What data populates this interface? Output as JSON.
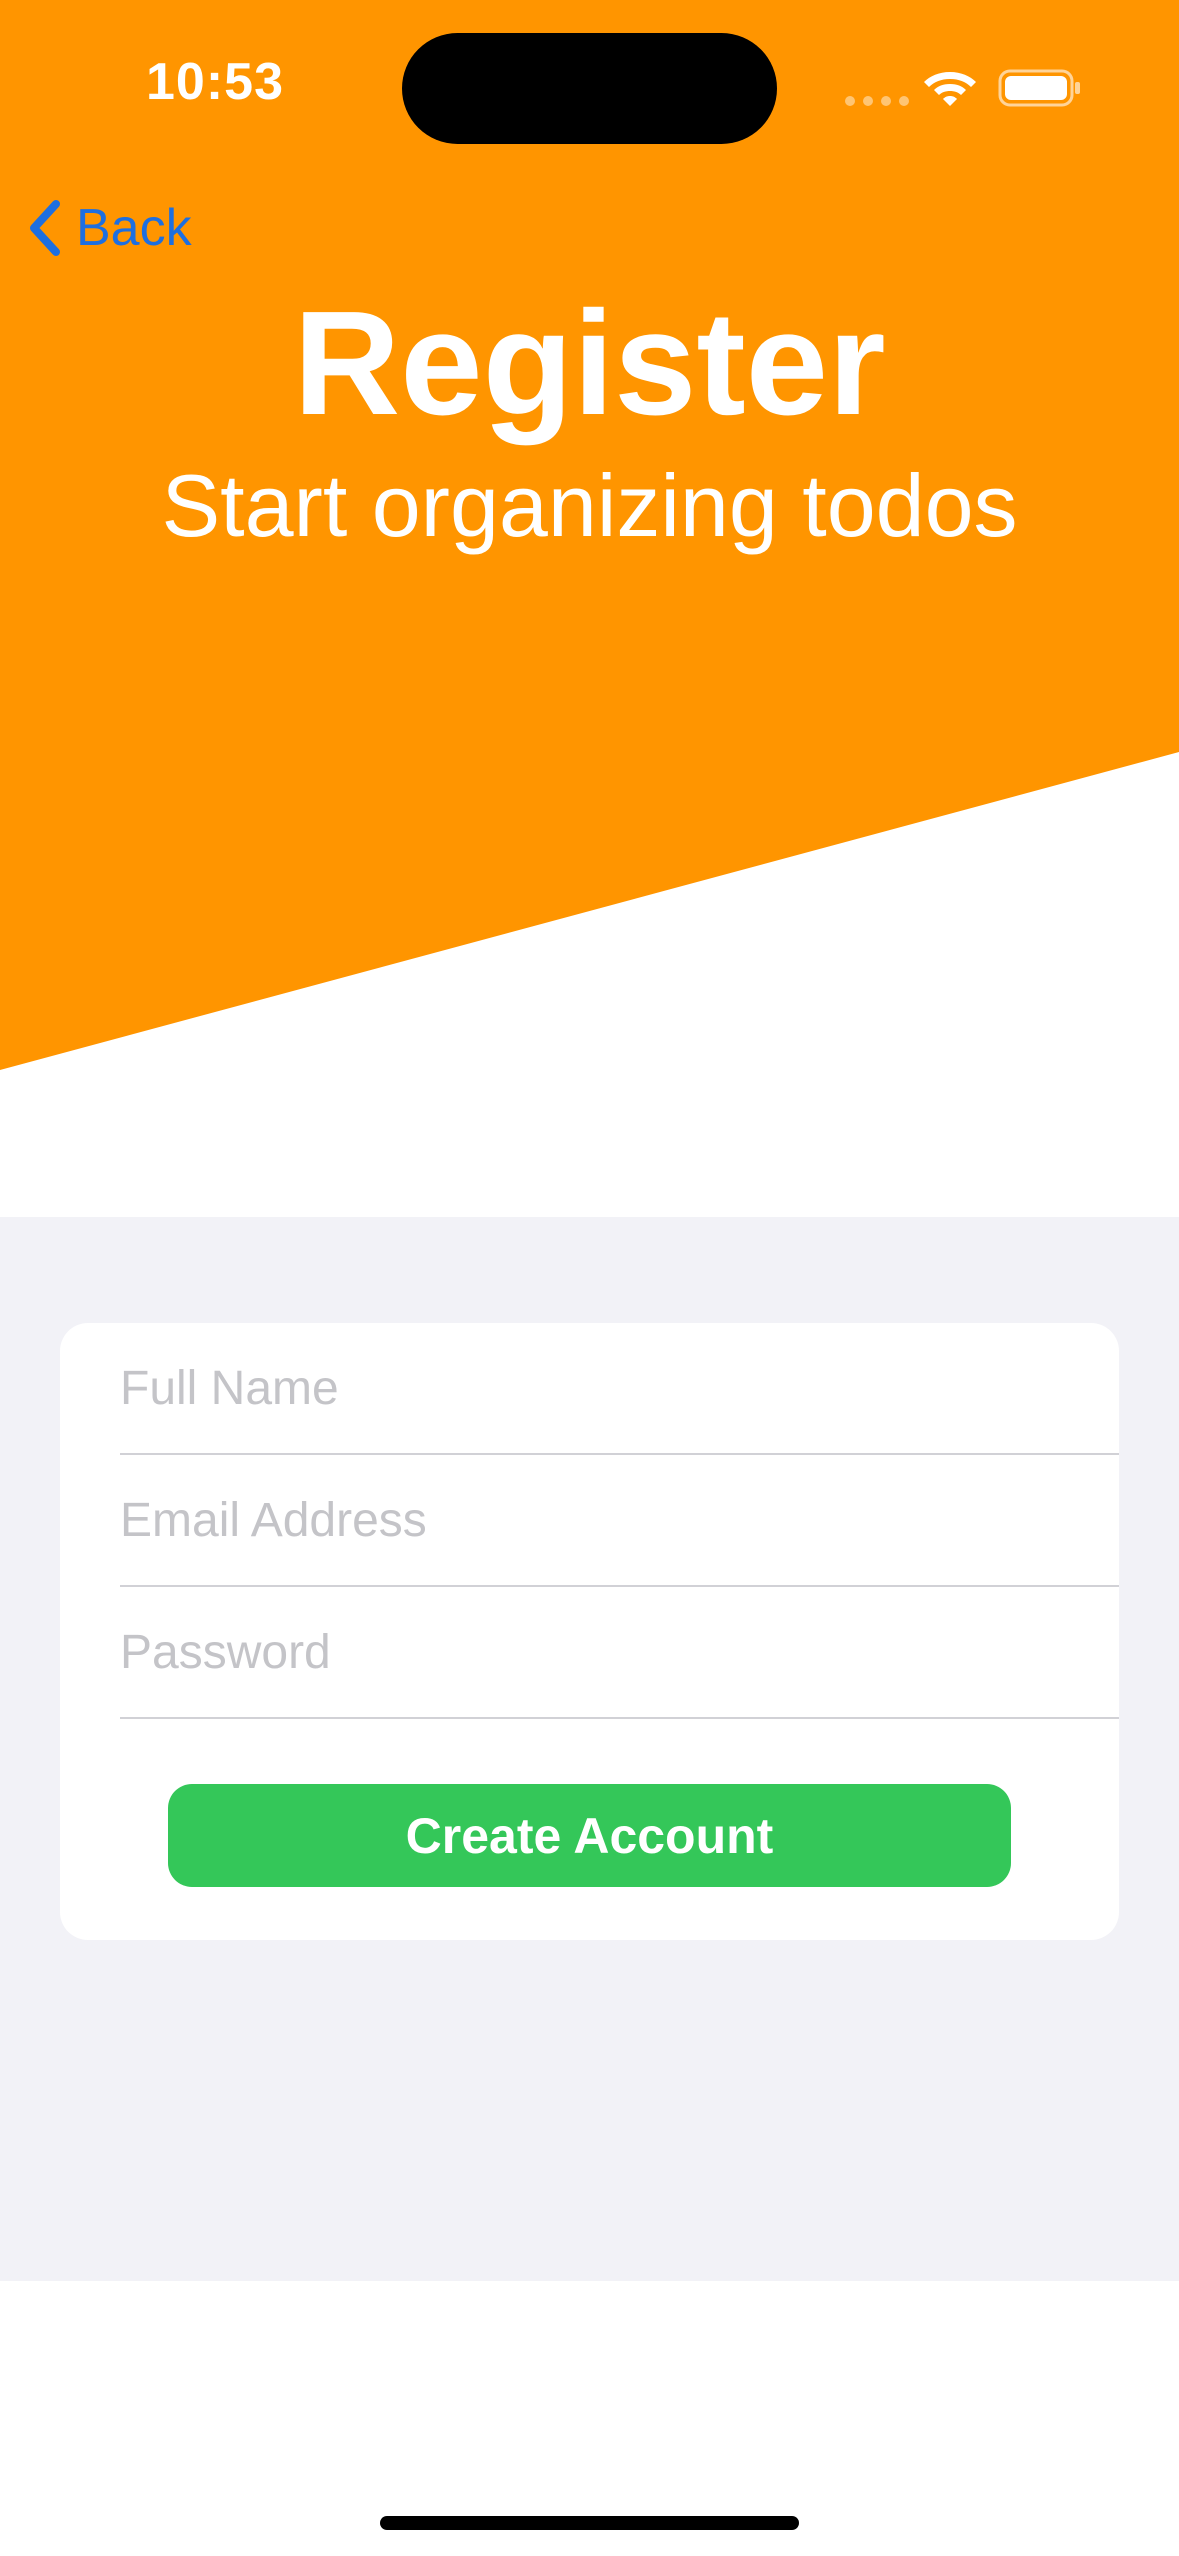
{
  "colors": {
    "header_orange": "#ff9500",
    "accent_blue": "#1e6fe0",
    "button_green": "#34c759",
    "form_background": "#f2f2f7",
    "card_background": "#ffffff"
  },
  "status_bar": {
    "time": "10:53",
    "icons": [
      "cellular-signal-icon",
      "wifi-icon",
      "battery-icon"
    ]
  },
  "nav": {
    "back_label": "Back",
    "back_icon": "chevron-left-icon"
  },
  "header": {
    "title": "Register",
    "subtitle": "Start organizing todos"
  },
  "form": {
    "full_name": {
      "placeholder": "Full Name",
      "value": ""
    },
    "email": {
      "placeholder": "Email Address",
      "value": ""
    },
    "password": {
      "placeholder": "Password",
      "value": ""
    },
    "submit_label": "Create Account"
  }
}
